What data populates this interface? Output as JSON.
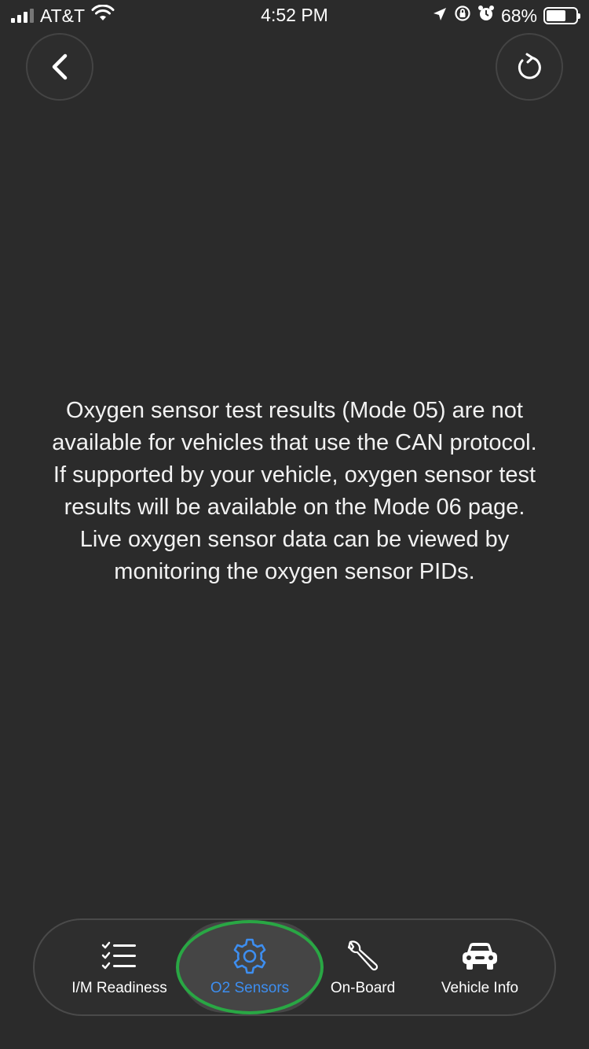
{
  "status_bar": {
    "carrier": "AT&T",
    "time": "4:52 PM",
    "battery_percent": "68%",
    "battery_level": 0.68
  },
  "header": {
    "back_icon": "chevron-left-icon",
    "refresh_icon": "refresh-icon"
  },
  "message": "Oxygen sensor test results (Mode 05) are not available for vehicles that use the CAN protocol. If supported by your vehicle, oxygen sensor test results will be available on the Mode 06 page. Live oxygen sensor data can be viewed by monitoring the oxygen sensor PIDs.",
  "tabs": [
    {
      "label": "I/M Readiness",
      "icon": "checklist-icon",
      "active": false
    },
    {
      "label": "O2 Sensors",
      "icon": "gear-icon",
      "active": true
    },
    {
      "label": "On-Board",
      "icon": "wrench-icon",
      "active": false
    },
    {
      "label": "Vehicle Info",
      "icon": "car-icon",
      "active": false
    }
  ],
  "colors": {
    "background": "#2b2b2b",
    "active_tab": "#3d8ef0",
    "highlight_ring": "#29a744"
  }
}
